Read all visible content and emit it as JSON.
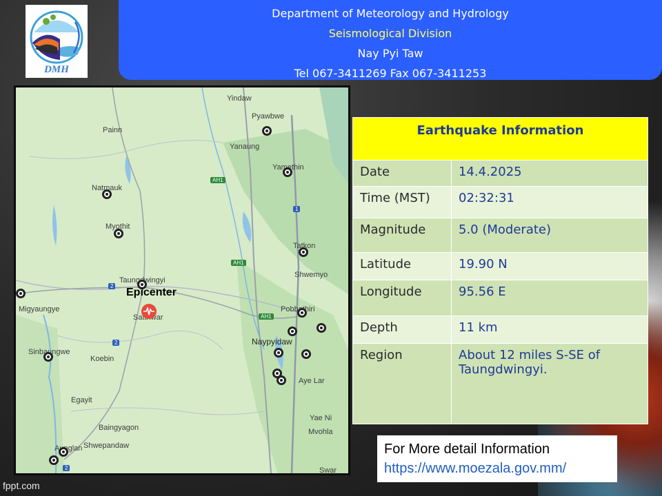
{
  "header": {
    "line1": "Department of Meteorology and Hydrology",
    "line2": "Seismological Division",
    "line3": "Nay Pyi Taw",
    "line4": "Tel 067-3411269 Fax 067-3411253"
  },
  "logo": {
    "text": "DMH"
  },
  "map": {
    "epicenter_label": "Epicenter",
    "places": {
      "yindaw": "Yindaw",
      "pyawbwe": "Pyawbwe",
      "yanaung": "Yanaung",
      "painn": "Painn",
      "natmauk": "Natmauk",
      "yamethin": "Yamethin",
      "myothit": "Myothit",
      "tatkon": "Tatkon",
      "shwemyo": "Shwemyo",
      "taungdwingyi": "Taungdwingyi",
      "migyaungye": "Migyaungye",
      "pobbathiri": "Pobbathiri",
      "satthwar": "Satthwar",
      "naypyidaw": "Naypyidaw",
      "sinbaungwe": "Sinbaungwe",
      "koebin": "Koebin",
      "ayelar": "Aye Lar",
      "egayit": "Egayit",
      "baingyagon": "Baingyagon",
      "shwepandaw": "Shwepandaw",
      "yaeni": "Yae Ni",
      "mvohla": "Mvohla",
      "aunglan": "Aunglan",
      "swar": "Swar"
    },
    "shields": {
      "ah1": "AH1",
      "r1": "1",
      "r2": "2"
    }
  },
  "info": {
    "title": "Earthquake Information",
    "rows": [
      {
        "key": "Date",
        "value": "14.4.2025"
      },
      {
        "key": "Time (MST)",
        "value": "02:32:31"
      },
      {
        "key": "Magnitude",
        "value": "5.0 (Moderate)"
      },
      {
        "key": "Latitude",
        "value": "19.90 N"
      },
      {
        "key": "Longitude",
        "value": "95.56 E"
      },
      {
        "key": "Depth",
        "value": "11 km"
      },
      {
        "key": "Region",
        "value": "About 12 miles S-SE of Taungdwingyi."
      }
    ]
  },
  "more": {
    "title": "For More detail Information",
    "url": "https://www.moezala.gov.mm/"
  },
  "watermark": "fppt.com",
  "colors": {
    "header_bg": "#2b5fff",
    "table_title_bg": "#ffff00",
    "row_dark": "#cfe2b4",
    "row_light": "#e9f3d9",
    "epicenter": "#e54b3c"
  }
}
